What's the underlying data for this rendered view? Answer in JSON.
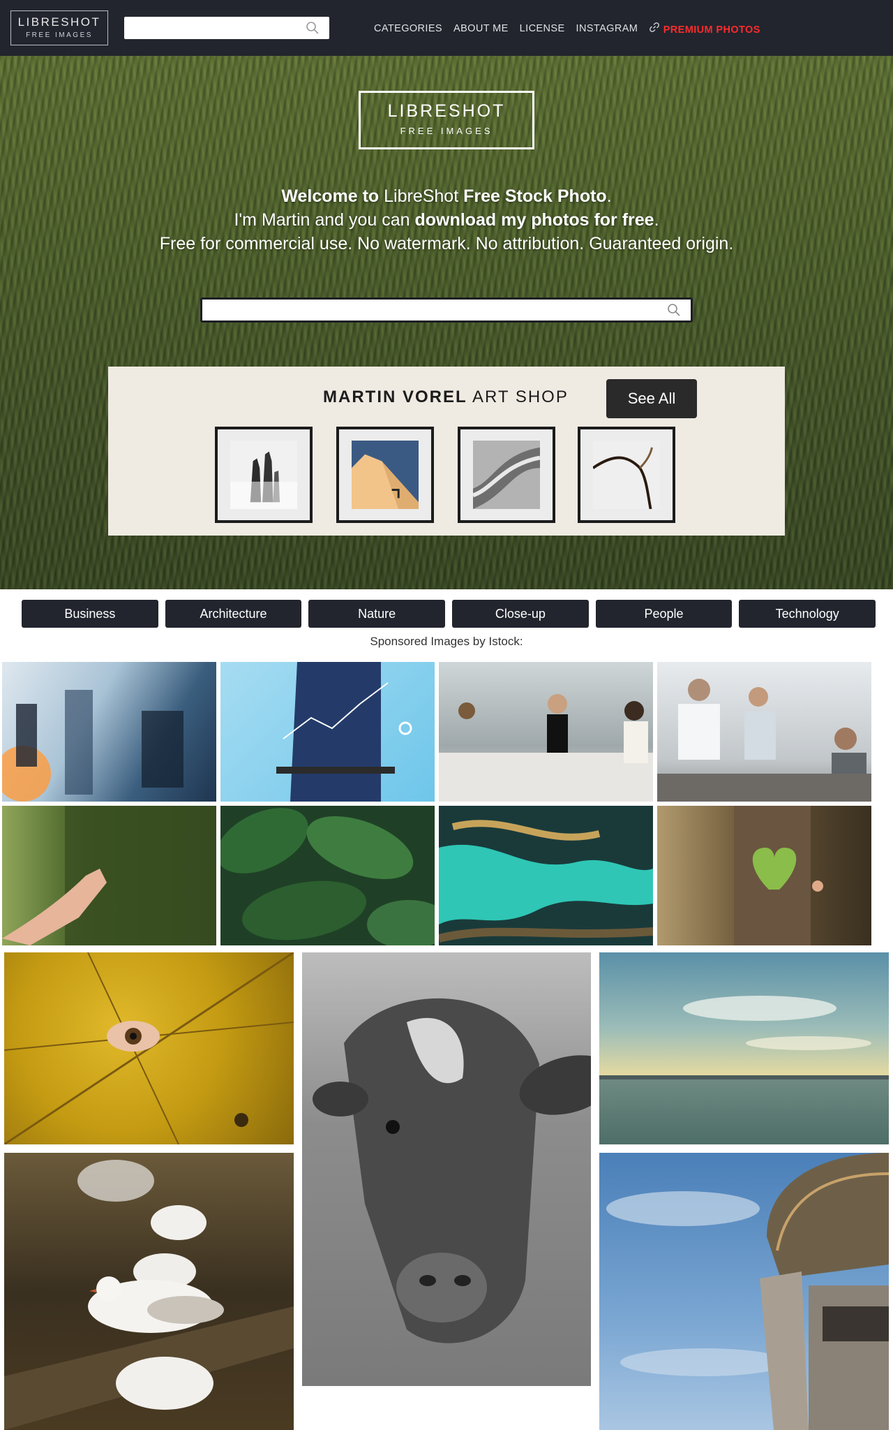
{
  "nav": {
    "logo_line1": "LIBRESHOT",
    "logo_line2": "FREE IMAGES",
    "search_placeholder": "",
    "menu": [
      "CATEGORIES",
      "ABOUT ME",
      "LICENSE",
      "INSTAGRAM"
    ],
    "premium": "PREMIUM PHOTOS"
  },
  "hero": {
    "logo_line1": "LIBRESHOT",
    "logo_line2": "FREE IMAGES",
    "line1_bold_a": "Welcome to",
    "line1_plain": " LibreShot ",
    "line1_bold_b": "Free Stock Photo",
    "line1_end": ".",
    "line2_plain": "I'm Martin and you can ",
    "line2_bold": "download my photos for free",
    "line2_end": ".",
    "line3": "Free for commercial use. No watermark. No attribution. Guaranteed origin.",
    "search_placeholder": ""
  },
  "shop": {
    "title_bold": "MARTIN VOREL",
    "title_plain": " ART SHOP",
    "see_all": "See All"
  },
  "categories": [
    "Business",
    "Architecture",
    "Nature",
    "Close-up",
    "People",
    "Technology"
  ],
  "sponsored_label": "Sponsored Images by Istock:",
  "colors": {
    "nav_bg": "#22252e",
    "premium": "#ff2b2b",
    "category_bg": "#22252e",
    "shop_bg": "#efeae2"
  }
}
